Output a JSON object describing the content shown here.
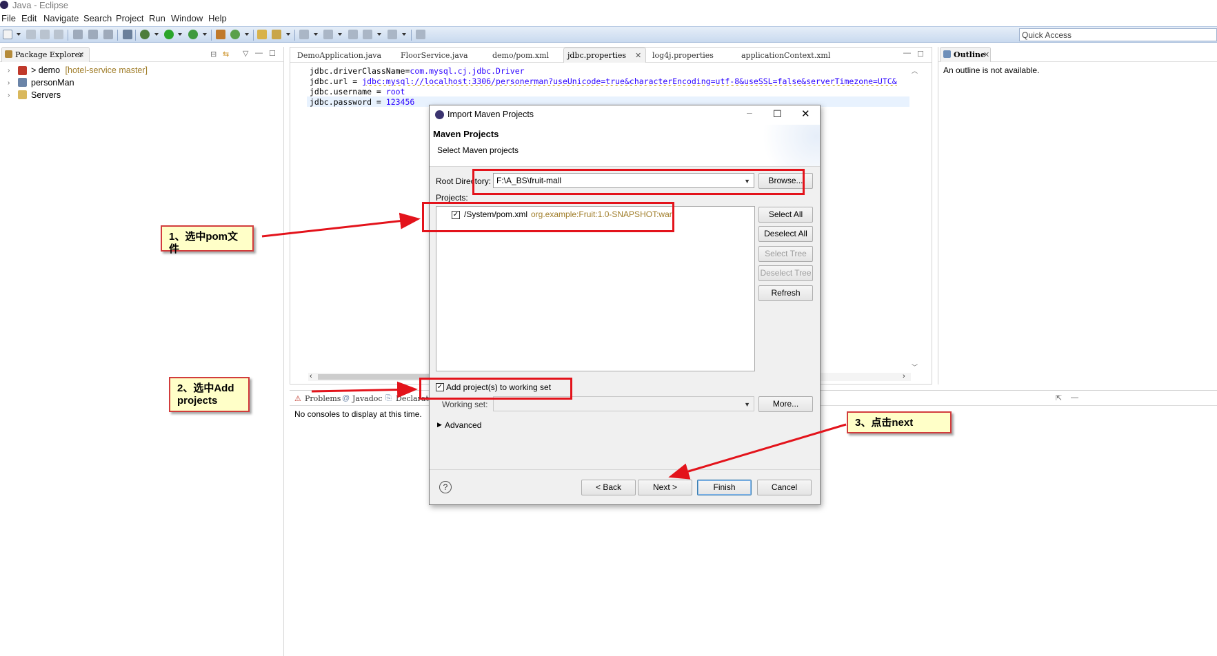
{
  "window": {
    "title": "Java - Eclipse"
  },
  "menu": [
    "File",
    "Edit",
    "Navigate",
    "Search",
    "Project",
    "Run",
    "Window",
    "Help"
  ],
  "toolbar": {
    "quick_access": "Quick Access"
  },
  "package_explorer": {
    "tab_label": "Package Explorer",
    "items": [
      {
        "label": "> demo",
        "decoration": "[hotel-service master]"
      },
      {
        "label": "personMan"
      },
      {
        "label": "Servers"
      }
    ]
  },
  "editor": {
    "tabs": [
      "DemoApplication.java",
      "FloorService.java",
      "demo/pom.xml",
      "jdbc.properties",
      "log4j.properties",
      "applicationContext.xml"
    ],
    "active_tab": "jdbc.properties",
    "lines": [
      {
        "key": "jdbc.driverClassName=",
        "value": "com.mysql.cj.jdbc.Driver"
      },
      {
        "key": "jdbc.url = ",
        "value": "jdbc:mysql://localhost:3306/personerman?useUnicode=true&characterEncoding=utf-8&useSSL=false&serverTimezone=UTC&"
      },
      {
        "key": "jdbc.username = ",
        "value": "root"
      },
      {
        "key": "jdbc.password = ",
        "value": "123456"
      }
    ]
  },
  "outline": {
    "tab_label": "Outline",
    "message": "An outline is not available."
  },
  "console": {
    "tabs": [
      "Problems",
      "Javadoc",
      "Declarati"
    ],
    "message": "No consoles to display at this time."
  },
  "dialog": {
    "title": "Import Maven Projects",
    "header_title": "Maven Projects",
    "header_subtitle": "Select Maven projects",
    "root_dir_label": "Root Directory:",
    "root_dir_value": "F:\\A_BS\\fruit-mall",
    "browse": "Browse...",
    "projects_label": "Projects:",
    "projects": [
      {
        "path": "/System/pom.xml",
        "artifact": "org.example:Fruit:1.0-SNAPSHOT:war",
        "checked": true
      }
    ],
    "side_buttons": {
      "select_all": "Select All",
      "deselect_all": "Deselect All",
      "select_tree": "Select Tree",
      "deselect_tree": "Deselect Tree",
      "refresh": "Refresh"
    },
    "add_to_working_set": "Add project(s) to working set",
    "add_to_working_set_checked": true,
    "working_set_label": "Working set:",
    "working_set_value": "",
    "more": "More...",
    "advanced": "Advanced",
    "footer": {
      "back": "< Back",
      "next": "Next >",
      "finish": "Finish",
      "cancel": "Cancel"
    }
  },
  "annotations": {
    "note1": "1、选中pom文件",
    "note2": "2、选中Add projects",
    "note3": "3、点击next"
  },
  "colors": {
    "annotation_red": "#e3131b",
    "note_bg": "#ffffc8",
    "link_blue": "#2a00ff",
    "artifact_gold": "#a07d29",
    "toolbar_blue": "#c9daef"
  }
}
